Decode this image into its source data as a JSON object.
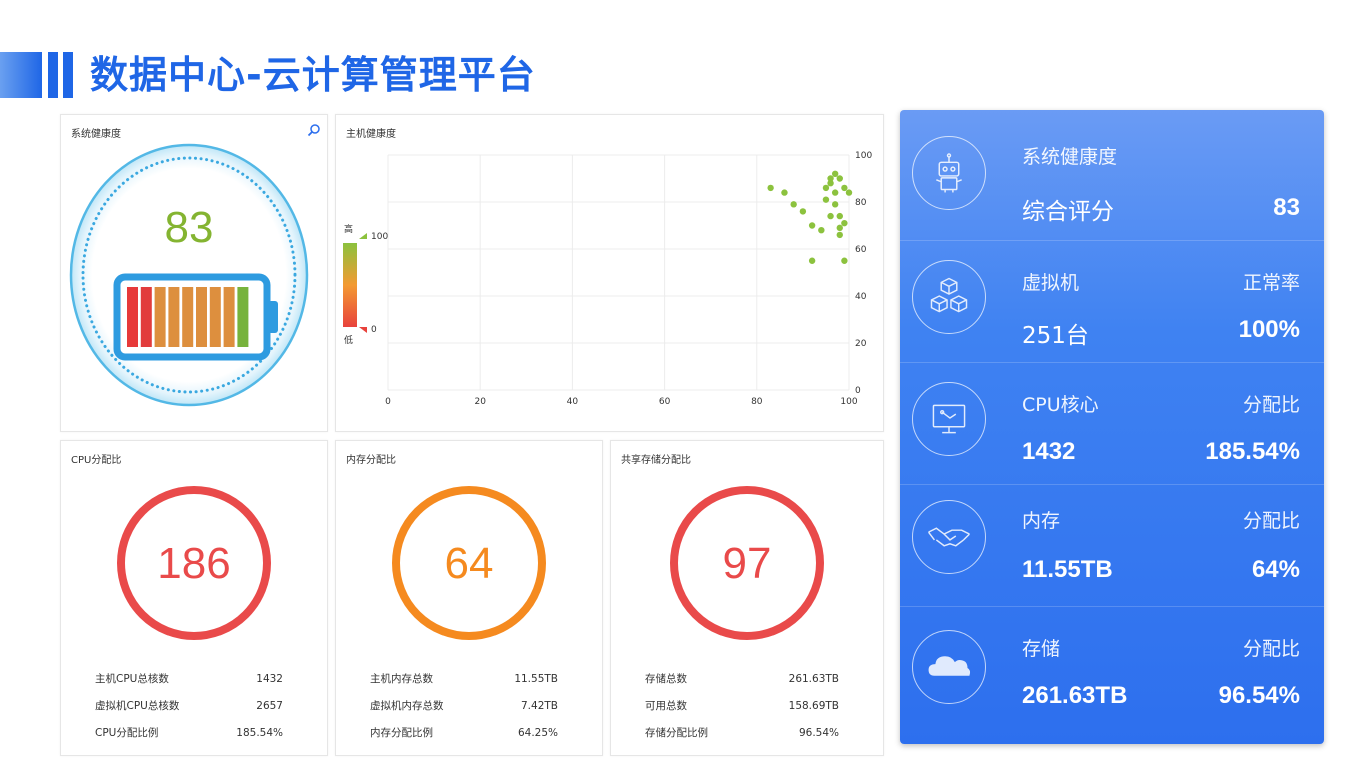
{
  "header": {
    "title": "数据中心-云计算管理平台"
  },
  "system_health": {
    "title": "系统健康度",
    "score": "83",
    "battery_colors": [
      "#e73a3a",
      "#e23c3c",
      "#dd8f3e",
      "#dd8f3e",
      "#dd8f3e",
      "#dd8f3e",
      "#dd8f3e",
      "#dd8f3e",
      "#77b33c"
    ]
  },
  "host_health": {
    "title": "主机健康度",
    "legend_high": "高",
    "legend_low": "低",
    "legend_max": "100",
    "legend_min": "0"
  },
  "chart_data": {
    "type": "scatter",
    "title": "主机健康度",
    "xlim": [
      0,
      100
    ],
    "ylim": [
      0,
      100
    ],
    "x_ticks": [
      "0",
      "20",
      "40",
      "60",
      "80",
      "100"
    ],
    "y_ticks": [
      "0",
      "20",
      "40",
      "60",
      "80",
      "100"
    ],
    "grid": true,
    "color_scale": [
      "#e8423c",
      "#f39a32",
      "#8cc23e"
    ],
    "points": [
      [
        83,
        86
      ],
      [
        86,
        84
      ],
      [
        88,
        79
      ],
      [
        90,
        76
      ],
      [
        92,
        70
      ],
      [
        92,
        55
      ],
      [
        94,
        68
      ],
      [
        95,
        81
      ],
      [
        95,
        86
      ],
      [
        96,
        88
      ],
      [
        96,
        90
      ],
      [
        97,
        92
      ],
      [
        97,
        84
      ],
      [
        97,
        79
      ],
      [
        98,
        74
      ],
      [
        98,
        66
      ],
      [
        98,
        69
      ],
      [
        98,
        90
      ],
      [
        99,
        86
      ],
      [
        99,
        71
      ],
      [
        99,
        55
      ],
      [
        100,
        84
      ],
      [
        96,
        74
      ]
    ]
  },
  "cpu": {
    "title": "CPU分配比",
    "value": "186",
    "color": "#e94a4a",
    "stats": [
      {
        "label": "主机CPU总核数",
        "value": "1432"
      },
      {
        "label": "虚拟机CPU总核数",
        "value": "2657"
      },
      {
        "label": "CPU分配比例",
        "value": "185.54%"
      }
    ]
  },
  "memory": {
    "title": "内存分配比",
    "value": "64",
    "color": "#f58a1f",
    "stats": [
      {
        "label": "主机内存总数",
        "value": "11.55TB"
      },
      {
        "label": "虚拟机内存总数",
        "value": "7.42TB"
      },
      {
        "label": "内存分配比例",
        "value": "64.25%"
      }
    ]
  },
  "storage": {
    "title": "共享存储分配比",
    "value": "97",
    "color": "#e94a4a",
    "stats": [
      {
        "label": "存储总数",
        "value": "261.63TB"
      },
      {
        "label": "可用总数",
        "value": "158.69TB"
      },
      {
        "label": "存储分配比例",
        "value": "96.54%"
      }
    ]
  },
  "summary": {
    "rows": [
      {
        "icon": "robot-icon",
        "label": "系统健康度",
        "right_label": "",
        "value": "综合评分",
        "right_value": "83"
      },
      {
        "icon": "cubes-icon",
        "label": "虚拟机",
        "right_label": "正常率",
        "value": "251台",
        "right_value": "100%"
      },
      {
        "icon": "monitor-icon",
        "label": "CPU核心",
        "right_label": "分配比",
        "value": "1432",
        "right_value": "185.54%"
      },
      {
        "icon": "handshake-icon",
        "label": "内存",
        "right_label": "分配比",
        "value": "11.55TB",
        "right_value": "64%"
      },
      {
        "icon": "cloud-icon",
        "label": "存储",
        "right_label": "分配比",
        "value": "261.63TB",
        "right_value": "96.54%"
      }
    ]
  }
}
